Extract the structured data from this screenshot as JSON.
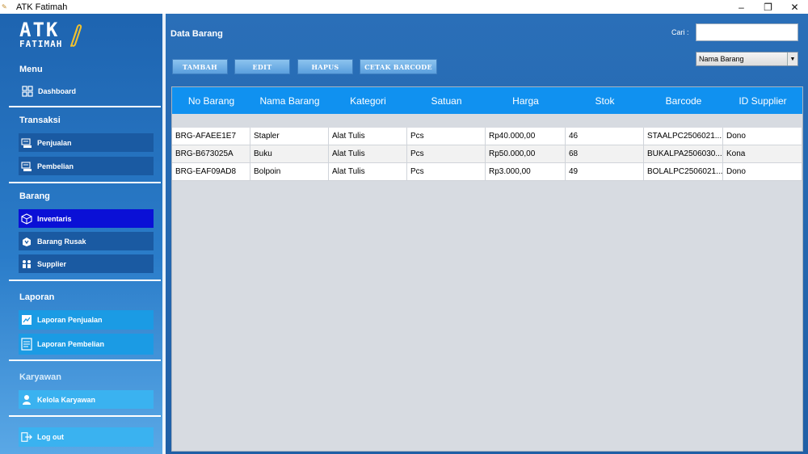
{
  "window": {
    "title": "ATK Fatimah",
    "minimize": "–",
    "restore": "❐",
    "close": "✕"
  },
  "logo": {
    "big": "ATK",
    "small": "FATIMAH"
  },
  "sidebar": {
    "menu_title": "Menu",
    "dashboard": "Dashboard",
    "transaksi_title": "Transaksi",
    "penjualan": "Penjualan",
    "pembelian": "Pembelian",
    "barang_title": "Barang",
    "inventaris": "Inventaris",
    "barang_rusak": "Barang Rusak",
    "supplier": "Supplier",
    "laporan_title": "Laporan",
    "laporan_penjualan": "Laporan Penjualan",
    "laporan_pembelian": "Laporan Pembelian",
    "karyawan_title": "Karyawan",
    "kelola_karyawan": "Kelola Karyawan",
    "logout": "Log out"
  },
  "main": {
    "title": "Data Barang",
    "search_label": "Cari :",
    "search_value": "",
    "filter_selected": "Nama Barang",
    "buttons": {
      "tambah": "TAMBAH",
      "edit": "EDIT",
      "hapus": "HAPUS",
      "cetak": "CETAK BARCODE"
    }
  },
  "table": {
    "headers": [
      "No Barang",
      "Nama Barang",
      "Kategori",
      "Satuan",
      "Harga",
      "Stok",
      "Barcode",
      "ID Supplier"
    ],
    "rows": [
      [
        "BRG-AFAEE1E7",
        "Stapler",
        "Alat Tulis",
        "Pcs",
        "Rp40.000,00",
        "46",
        "STAALPC2506021...",
        "Dono"
      ],
      [
        "BRG-B673025A",
        "Buku",
        "Alat Tulis",
        "Pcs",
        "Rp50.000,00",
        "68",
        "BUKALPA2506030...",
        "Kona"
      ],
      [
        "BRG-EAF09AD8",
        "Bolpoin",
        "Alat Tulis",
        "Pcs",
        "Rp3.000,00",
        "49",
        "BOLALPC2506021...",
        "Dono"
      ]
    ]
  },
  "colors": {
    "sidebar_active": "#0a10d6",
    "table_header": "#1091f0",
    "frame_blue": "#1f5fa6"
  }
}
